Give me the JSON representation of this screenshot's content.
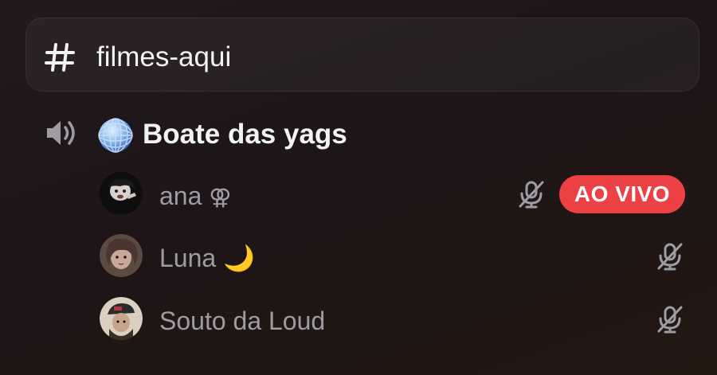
{
  "text_channel": {
    "name": "filmes-aqui",
    "icon": "hash-icon"
  },
  "voice_channel": {
    "name": "Boate das yags",
    "icons": [
      "speaker-icon",
      "disco-ball-icon"
    ]
  },
  "members": [
    {
      "name": "ana",
      "suffix": "⚢",
      "muted": true,
      "live": true,
      "live_label": "AO VIVO"
    },
    {
      "name": "Luna",
      "suffix": "🌙",
      "muted": true,
      "live": false
    },
    {
      "name": "Souto da Loud",
      "suffix": "",
      "muted": true,
      "live": false
    }
  ],
  "colors": {
    "live": "#ed4245",
    "text": "#f2f3f5",
    "muted_text": "#9d9ca3"
  }
}
